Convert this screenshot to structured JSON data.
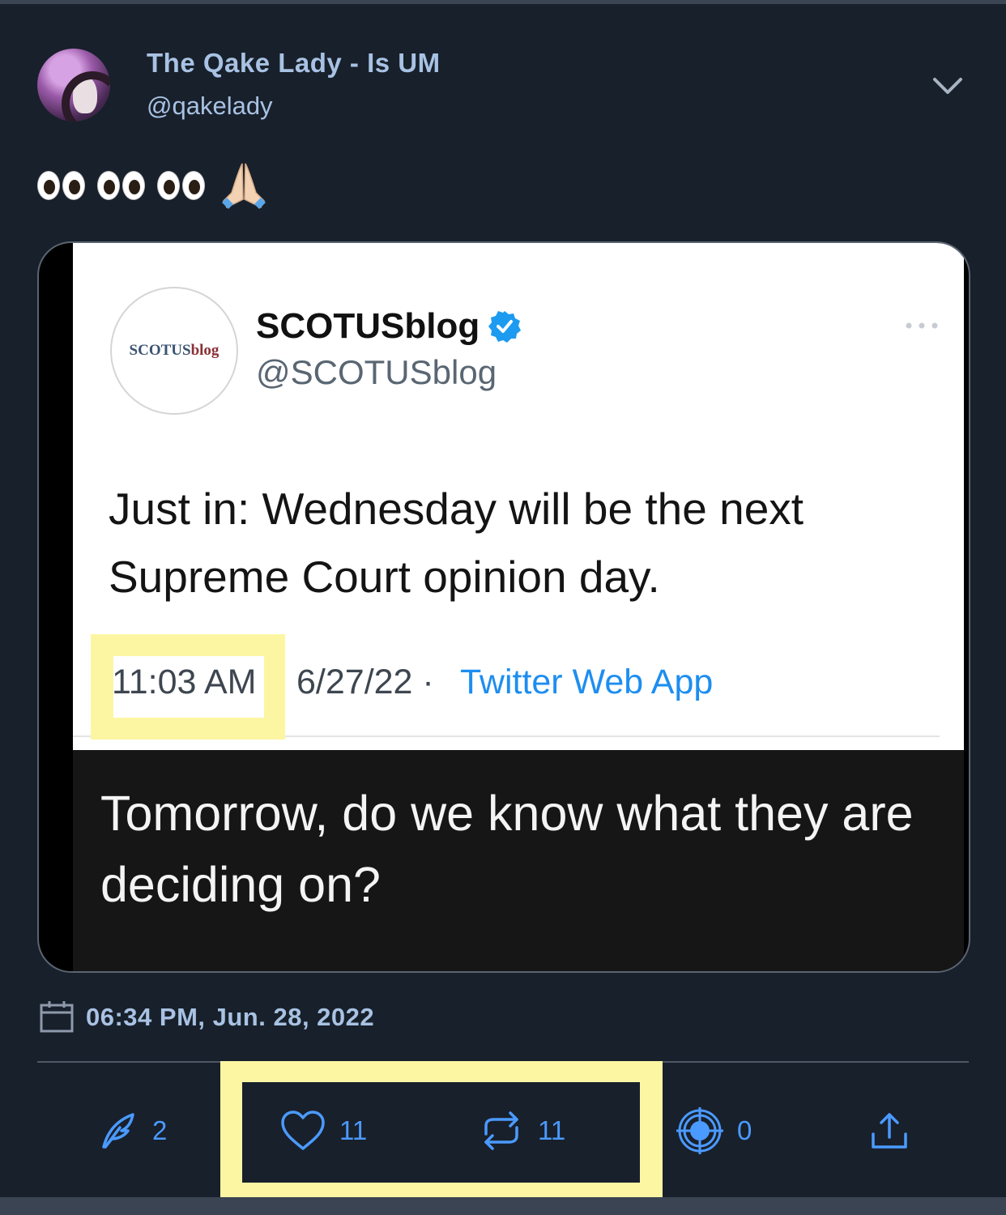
{
  "post": {
    "display_name": "The Qake Lady - Is UM",
    "handle": "@qakelady",
    "timestamp": "06:34 PM, Jun. 28, 2022"
  },
  "quoted": {
    "logo_text_a": "SCOTUS",
    "logo_text_b": "blog",
    "name": "SCOTUSblog",
    "handle": "@SCOTUSblog",
    "text": "Just in: Wednesday will be the next Supreme Court opinion day.",
    "time": "11:03 AM",
    "date": "6/27/22 · ",
    "app": "Twitter Web App",
    "reply_text": "Tomorrow, do we know what they are deciding on?"
  },
  "actions": {
    "reply_count": "2",
    "like_count": "11",
    "repost_count": "11",
    "target_count": "0"
  },
  "icons": {
    "menu": "chevron-down-icon",
    "calendar": "calendar-icon",
    "reply": "feather-icon",
    "like": "heart-icon",
    "repost": "repost-icon",
    "target": "crosshair-icon",
    "share": "share-icon",
    "verified": "verified-badge-icon"
  },
  "colors": {
    "background": "#18202b",
    "name_text": "#a8c2e3",
    "action_blue": "#4b9aff",
    "highlight": "#fcf6a3",
    "twitter_blue": "#1d8ef0"
  }
}
